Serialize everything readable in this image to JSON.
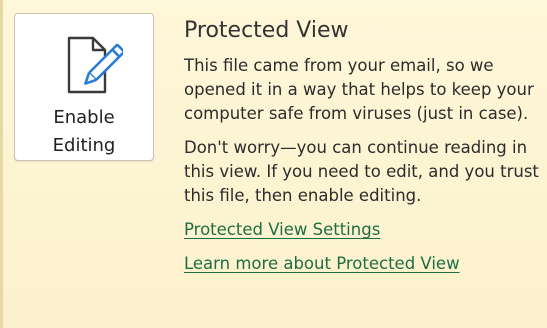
{
  "protected_view": {
    "title": "Protected View",
    "message_1": "This file came from your email, so we opened it in a way that helps to keep your computer safe from viruses (just in case).",
    "message_2": "Don't worry—you can continue reading in this view. If you need to edit, and you trust this file, then enable editing.",
    "settings_link": "Protected View Settings",
    "learn_more_link": "Learn more about Protected View"
  },
  "enable_button": {
    "line_1": "Enable",
    "line_2": "Editing",
    "icon": "document-edit-icon"
  },
  "colors": {
    "background": "#fdf4d4",
    "link": "#1f6e43",
    "pencil": "#2b7cd3"
  }
}
